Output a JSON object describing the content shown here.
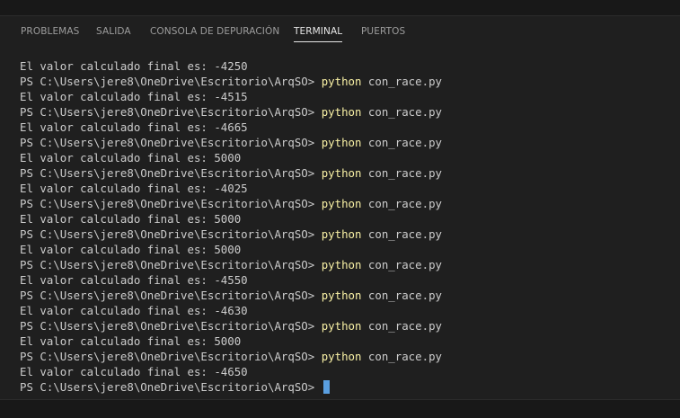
{
  "tabs": [
    {
      "label": "PROBLEMAS"
    },
    {
      "label": "SALIDA"
    },
    {
      "label": "CONSOLA DE DEPURACIÓN"
    },
    {
      "label": "TERMINAL"
    },
    {
      "label": "PUERTOS"
    }
  ],
  "active_tab": "TERMINAL",
  "prompt": "PS C:\\Users\\jere8\\OneDrive\\Escritorio\\ArqSO> ",
  "command_program": "python",
  "command_args": " con_race.py",
  "output": [
    "El valor calculado final es: -4250",
    "El valor calculado final es: -4515",
    "El valor calculado final es: -4665",
    "El valor calculado final es: 5000",
    "El valor calculado final es: -4025",
    "El valor calculado final es: 5000",
    "El valor calculado final es: 5000",
    "El valor calculado final es: -4550",
    "El valor calculado final es: -4630",
    "El valor calculado final es: 5000",
    "El valor calculado final es: -4650"
  ],
  "colors": {
    "background": "#1f1f1f",
    "text": "#cccccc",
    "command": "#f9f1a5",
    "cursor": "#5a9fe0"
  }
}
